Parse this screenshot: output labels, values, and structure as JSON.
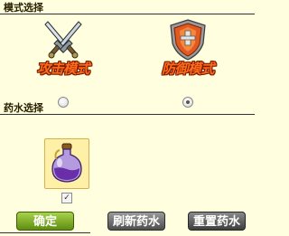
{
  "mode_section": {
    "title": "模式选择",
    "options": [
      {
        "label": "攻击模式",
        "icon": "crossed-swords-icon",
        "selected": false
      },
      {
        "label": "防御模式",
        "icon": "shield-icon",
        "selected": true
      }
    ]
  },
  "potion_section": {
    "title": "药水选择",
    "items": [
      {
        "icon": "purple-potion-bottle-icon",
        "checked": true,
        "check_mark": "✓"
      }
    ]
  },
  "buttons": {
    "confirm": "确定",
    "refresh": "刷新药水",
    "reset": "重置药水"
  },
  "colors": {
    "background": "#ffffdf",
    "confirm_button": "#7db02a",
    "secondary_button": "#5a5a5a",
    "mode_label": "#ff6a1a"
  }
}
